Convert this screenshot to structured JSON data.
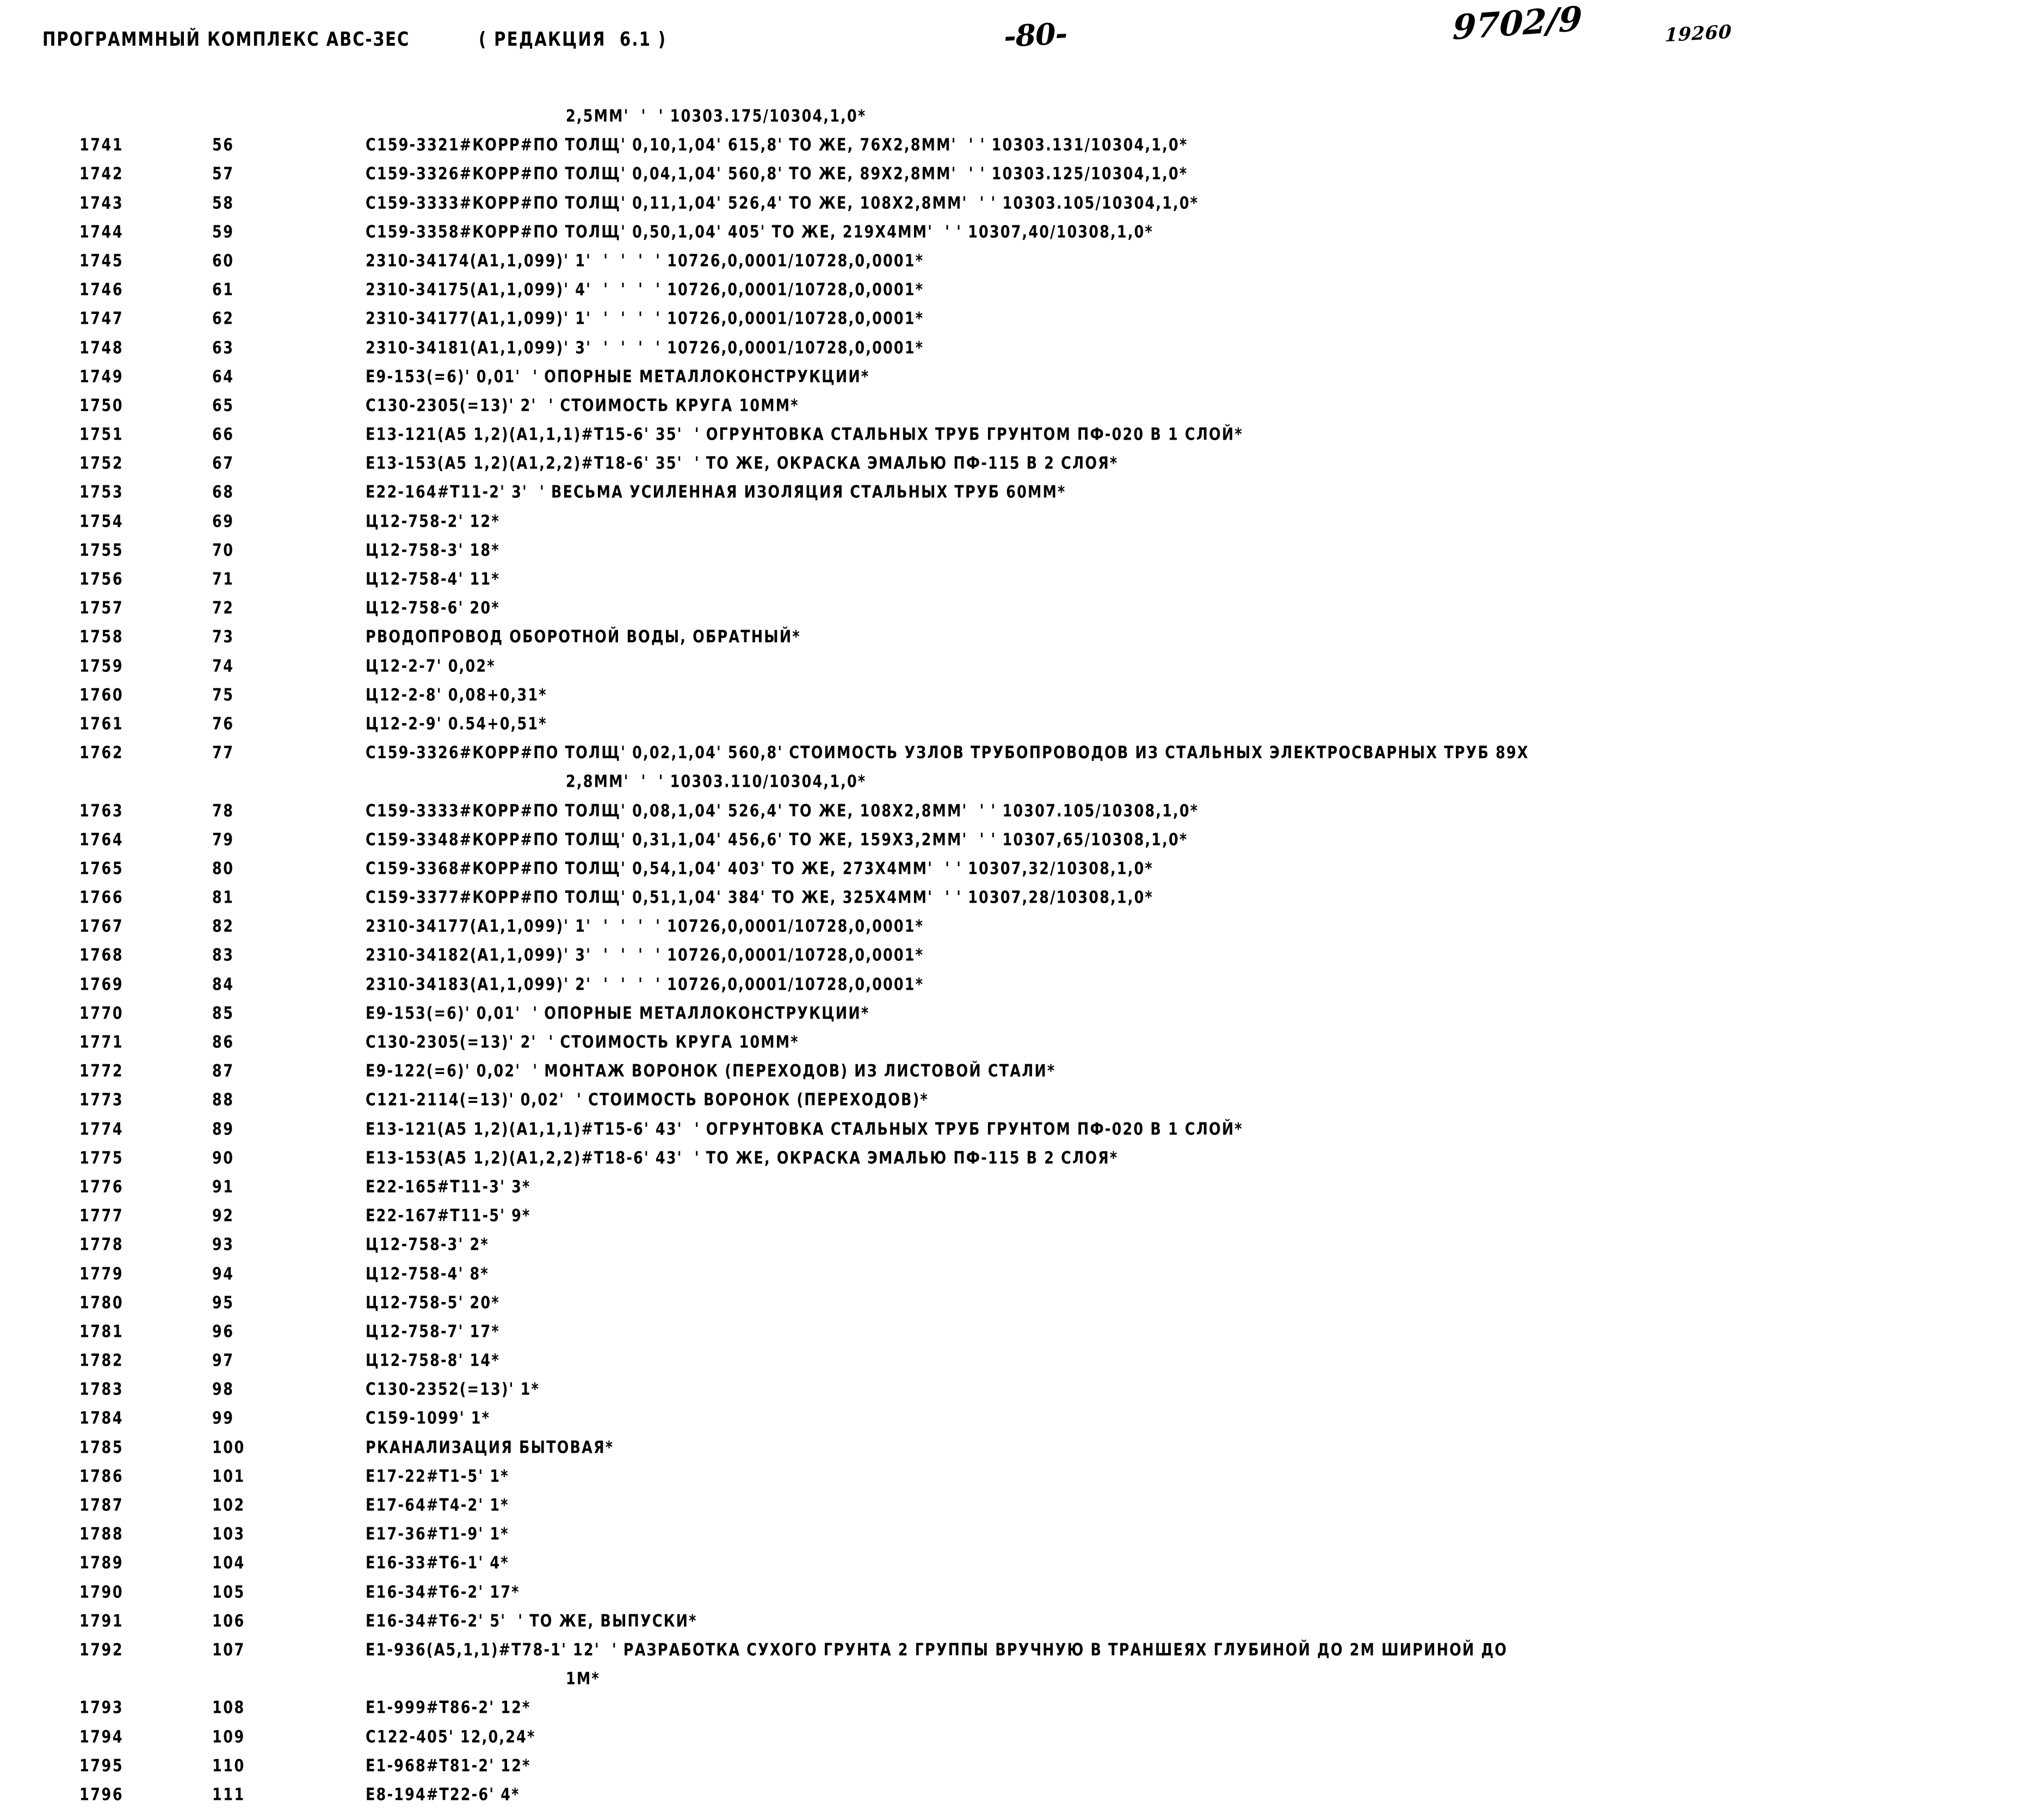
{
  "header": {
    "program_title": "ПРОГРАММНЫЙ КОМПЛЕКС АВС-ЗЕС",
    "revision": "( РЕДАКЦИЯ  6.1 )",
    "page_number": "-80-",
    "doc_code": "9702/9",
    "doc_serial": "19260"
  },
  "listing": {
    "first_line_continuation": "2,5ММ'  '  ' 10303.175/10304,1,0*",
    "rows": [
      {
        "seq": "",
        "num": "",
        "text": "2,5ММ'  '  ' 10303.175/10304,1,0*",
        "cont": true
      },
      {
        "seq": "1741",
        "num": "56",
        "text": "С159-3321#КОРР#ПО ТОЛЩ' 0,10,1,04' 615,8' ТО ЖЕ, 76Х2,8ММ'  ' ' 10303.131/10304,1,0*"
      },
      {
        "seq": "1742",
        "num": "57",
        "text": "С159-3326#КОРР#ПО ТОЛЩ' 0,04,1,04' 560,8' ТО ЖЕ, 89Х2,8ММ'  ' ' 10303.125/10304,1,0*"
      },
      {
        "seq": "1743",
        "num": "58",
        "text": "С159-3333#КОРР#ПО ТОЛЩ' 0,11,1,04' 526,4' ТО ЖЕ, 108Х2,8ММ'  ' ' 10303.105/10304,1,0*"
      },
      {
        "seq": "1744",
        "num": "59",
        "text": "С159-3358#КОРР#ПО ТОЛЩ' 0,50,1,04' 405' ТО ЖЕ, 219Х4ММ'  ' ' 10307,40/10308,1,0*"
      },
      {
        "seq": "1745",
        "num": "60",
        "text": "2310-34174(А1,1,099)' 1'  '  '  '  ' 10726,0,0001/10728,0,0001*"
      },
      {
        "seq": "1746",
        "num": "61",
        "text": "2310-34175(А1,1,099)' 4'  '  '  '  ' 10726,0,0001/10728,0,0001*"
      },
      {
        "seq": "1747",
        "num": "62",
        "text": "2310-34177(А1,1,099)' 1'  '  '  '  ' 10726,0,0001/10728,0,0001*"
      },
      {
        "seq": "1748",
        "num": "63",
        "text": "2310-34181(А1,1,099)' 3'  '  '  '  ' 10726,0,0001/10728,0,0001*"
      },
      {
        "seq": "1749",
        "num": "64",
        "text": "Е9-153(=6)' 0,01'  ' ОПОРНЫЕ МЕТАЛЛОКОНСТРУКЦИИ*"
      },
      {
        "seq": "1750",
        "num": "65",
        "text": "С130-2305(=13)' 2'  ' СТОИМОСТЬ КРУГА 10ММ*"
      },
      {
        "seq": "1751",
        "num": "66",
        "text": "Е13-121(А5 1,2)(А1,1,1)#Т15-6' 35'  ' ОГРУНТОВКА СТАЛЬНЫХ ТРУБ ГРУНТОМ ПФ-020 В 1 СЛОЙ*"
      },
      {
        "seq": "1752",
        "num": "67",
        "text": "Е13-153(А5 1,2)(А1,2,2)#Т18-6' 35'  ' ТО ЖЕ, ОКРАСКА ЭМАЛЬЮ ПФ-115 В 2 СЛОЯ*"
      },
      {
        "seq": "1753",
        "num": "68",
        "text": "Е22-164#Т11-2' 3'  ' ВЕСЬМА УСИЛЕННАЯ ИЗОЛЯЦИЯ СТАЛЬНЫХ ТРУБ 60ММ*"
      },
      {
        "seq": "1754",
        "num": "69",
        "text": "Ц12-758-2' 12*"
      },
      {
        "seq": "1755",
        "num": "70",
        "text": "Ц12-758-3' 18*"
      },
      {
        "seq": "1756",
        "num": "71",
        "text": "Ц12-758-4' 11*"
      },
      {
        "seq": "1757",
        "num": "72",
        "text": "Ц12-758-6' 20*"
      },
      {
        "seq": "1758",
        "num": "73",
        "text": "РВОДОПРОВОД ОБОРОТНОЙ ВОДЫ, ОБРАТНЫЙ*"
      },
      {
        "seq": "1759",
        "num": "74",
        "text": "Ц12-2-7' 0,02*"
      },
      {
        "seq": "1760",
        "num": "75",
        "text": "Ц12-2-8' 0,08+0,31*"
      },
      {
        "seq": "1761",
        "num": "76",
        "text": "Ц12-2-9' 0.54+0,51*"
      },
      {
        "seq": "1762",
        "num": "77",
        "text": "С159-3326#КОРР#ПО ТОЛЩ' 0,02,1,04' 560,8' СТОИМОСТЬ УЗЛОВ ТРУБОПРОВОДОВ ИЗ СТАЛЬНЫХ ЭЛЕКТРОСВАРНЫХ ТРУБ 89Х"
      },
      {
        "seq": "",
        "num": "",
        "text": "2,8ММ'  '  ' 10303.110/10304,1,0*",
        "cont": true
      },
      {
        "seq": "1763",
        "num": "78",
        "text": "С159-3333#КОРР#ПО ТОЛЩ' 0,08,1,04' 526,4' ТО ЖЕ, 108Х2,8ММ'  ' ' 10307.105/10308,1,0*"
      },
      {
        "seq": "1764",
        "num": "79",
        "text": "С159-3348#КОРР#ПО ТОЛЩ' 0,31,1,04' 456,6' ТО ЖЕ, 159Х3,2ММ'  ' ' 10307,65/10308,1,0*"
      },
      {
        "seq": "1765",
        "num": "80",
        "text": "С159-3368#КОРР#ПО ТОЛЩ' 0,54,1,04' 403' ТО ЖЕ, 273Х4ММ'  ' ' 10307,32/10308,1,0*"
      },
      {
        "seq": "1766",
        "num": "81",
        "text": "С159-3377#КОРР#ПО ТОЛЩ' 0,51,1,04' 384' ТО ЖЕ, 325Х4ММ'  ' ' 10307,28/10308,1,0*"
      },
      {
        "seq": "1767",
        "num": "82",
        "text": "2310-34177(А1,1,099)' 1'  '  '  '  ' 10726,0,0001/10728,0,0001*"
      },
      {
        "seq": "1768",
        "num": "83",
        "text": "2310-34182(А1,1,099)' 3'  '  '  '  ' 10726,0,0001/10728,0,0001*"
      },
      {
        "seq": "1769",
        "num": "84",
        "text": "2310-34183(А1,1,099)' 2'  '  '  '  ' 10726,0,0001/10728,0,0001*"
      },
      {
        "seq": "1770",
        "num": "85",
        "text": "Е9-153(=6)' 0,01'  ' ОПОРНЫЕ МЕТАЛЛОКОНСТРУКЦИИ*"
      },
      {
        "seq": "1771",
        "num": "86",
        "text": "С130-2305(=13)' 2'  ' СТОИМОСТЬ КРУГА 10ММ*"
      },
      {
        "seq": "1772",
        "num": "87",
        "text": "Е9-122(=6)' 0,02'  ' МОНТАЖ ВОРОНОК (ПЕРЕХОДОВ) ИЗ ЛИСТОВОЙ СТАЛИ*"
      },
      {
        "seq": "1773",
        "num": "88",
        "text": "С121-2114(=13)' 0,02'  ' СТОИМОСТЬ ВОРОНОК (ПЕРЕХОДОВ)*"
      },
      {
        "seq": "1774",
        "num": "89",
        "text": "Е13-121(А5 1,2)(А1,1,1)#Т15-6' 43'  ' ОГРУНТОВКА СТАЛЬНЫХ ТРУБ ГРУНТОМ ПФ-020 В 1 СЛОЙ*"
      },
      {
        "seq": "1775",
        "num": "90",
        "text": "Е13-153(А5 1,2)(А1,2,2)#Т18-6' 43'  ' ТО ЖЕ, ОКРАСКА ЭМАЛЬЮ ПФ-115 В 2 СЛОЯ*"
      },
      {
        "seq": "1776",
        "num": "91",
        "text": "Е22-165#Т11-3' 3*"
      },
      {
        "seq": "1777",
        "num": "92",
        "text": "Е22-167#Т11-5' 9*"
      },
      {
        "seq": "1778",
        "num": "93",
        "text": "Ц12-758-3' 2*"
      },
      {
        "seq": "1779",
        "num": "94",
        "text": "Ц12-758-4' 8*"
      },
      {
        "seq": "1780",
        "num": "95",
        "text": "Ц12-758-5' 20*"
      },
      {
        "seq": "1781",
        "num": "96",
        "text": "Ц12-758-7' 17*"
      },
      {
        "seq": "1782",
        "num": "97",
        "text": "Ц12-758-8' 14*"
      },
      {
        "seq": "1783",
        "num": "98",
        "text": "С130-2352(=13)' 1*"
      },
      {
        "seq": "1784",
        "num": "99",
        "text": "С159-1099' 1*"
      },
      {
        "seq": "1785",
        "num": "100",
        "text": "РКАНАЛИЗАЦИЯ БЫТОВАЯ*"
      },
      {
        "seq": "1786",
        "num": "101",
        "text": "Е17-22#Т1-5' 1*"
      },
      {
        "seq": "1787",
        "num": "102",
        "text": "Е17-64#Т4-2' 1*"
      },
      {
        "seq": "1788",
        "num": "103",
        "text": "Е17-36#Т1-9' 1*"
      },
      {
        "seq": "1789",
        "num": "104",
        "text": "Е16-33#Т6-1' 4*"
      },
      {
        "seq": "1790",
        "num": "105",
        "text": "Е16-34#Т6-2' 17*"
      },
      {
        "seq": "1791",
        "num": "106",
        "text": "Е16-34#Т6-2' 5'  ' ТО ЖЕ, ВЫПУСКИ*"
      },
      {
        "seq": "1792",
        "num": "107",
        "text": "Е1-936(А5,1,1)#Т78-1' 12'  ' РАЗРАБОТКА СУХОГО ГРУНТА 2 ГРУППЫ ВРУЧНУЮ В ТРАНШЕЯХ ГЛУБИНОЙ ДО 2М ШИРИНОЙ ДО"
      },
      {
        "seq": "",
        "num": "",
        "text": "1М*",
        "cont": true
      },
      {
        "seq": "1793",
        "num": "108",
        "text": "Е1-999#Т86-2' 12*"
      },
      {
        "seq": "1794",
        "num": "109",
        "text": "С122-405' 12,0,24*"
      },
      {
        "seq": "1795",
        "num": "110",
        "text": "Е1-968#Т81-2' 12*"
      },
      {
        "seq": "1796",
        "num": "111",
        "text": "Е8-194#Т22-6' 4*"
      }
    ]
  }
}
